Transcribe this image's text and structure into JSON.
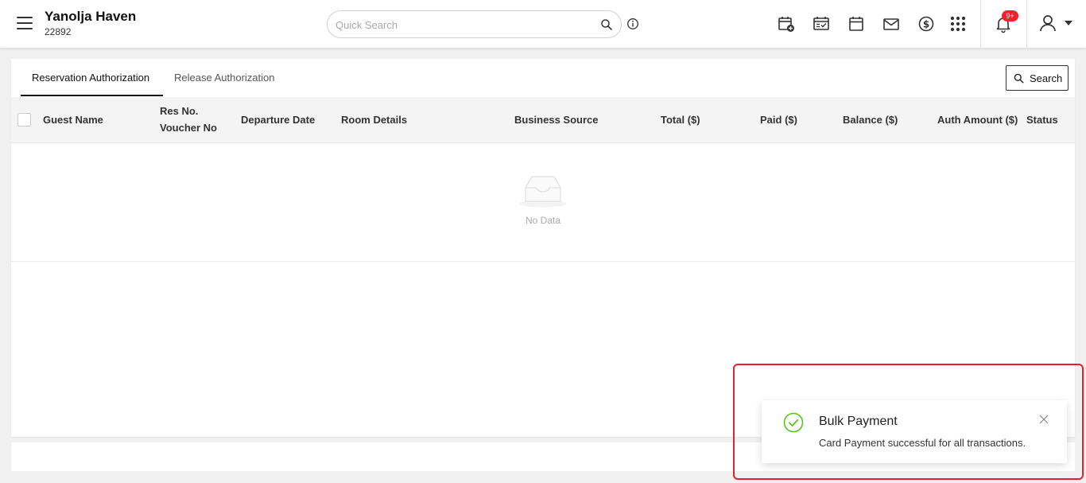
{
  "header": {
    "hotel_name": "Yanolja Haven",
    "hotel_id": "22892",
    "search_placeholder": "Quick Search",
    "notification_count": "9+",
    "icons": [
      "menu-icon",
      "search-icon",
      "info-icon",
      "add-reservation-icon",
      "checklist-calendar-icon",
      "calendar-icon",
      "mail-icon",
      "dollar-icon",
      "apps-grid-icon",
      "bell-icon",
      "user-icon",
      "caret-down-icon"
    ]
  },
  "tabs": [
    {
      "label": "Reservation Authorization",
      "active": true
    },
    {
      "label": "Release Authorization",
      "active": false
    }
  ],
  "search_button": "Search",
  "table": {
    "columns": {
      "guest_name": "Guest Name",
      "res_no": "Res No.",
      "voucher_no": "Voucher No",
      "departure_date": "Departure Date",
      "room_details": "Room Details",
      "business_source": "Business Source",
      "total": "Total ($)",
      "paid": "Paid ($)",
      "balance": "Balance ($)",
      "auth_amount": "Auth Amount ($)",
      "status": "Status"
    },
    "rows": [],
    "empty_text": "No Data"
  },
  "notification": {
    "title": "Bulk Payment",
    "message": "Card Payment successful for all transactions.",
    "status_color": "#52c41a",
    "highlight_color": "#e0242c"
  }
}
